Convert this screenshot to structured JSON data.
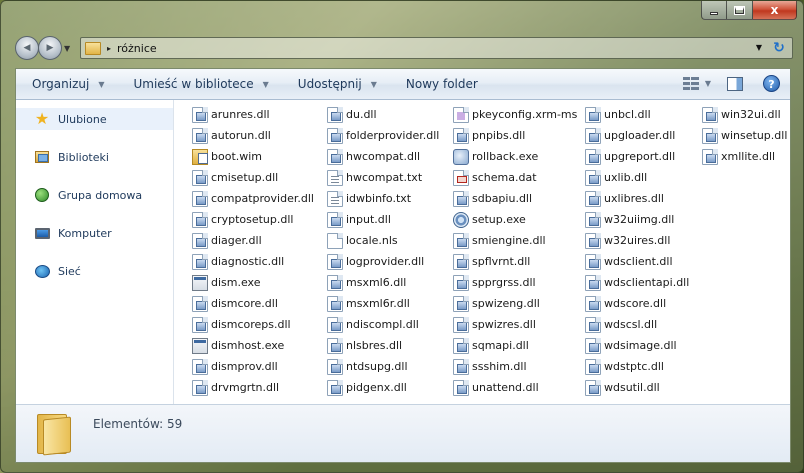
{
  "window": {
    "caption": {
      "minimize": "",
      "maximize": "",
      "close": "x"
    }
  },
  "address_bar": {
    "back_glyph": "◀",
    "forward_glyph": "▶",
    "breadcrumb_separator": "▸",
    "folder": "różnice",
    "dropdown_glyph": "▼",
    "refresh_glyph": "↻"
  },
  "toolbar": {
    "organize": "Organizuj",
    "include_in_library": "Umieść w bibliotece",
    "share": "Udostępnij",
    "new_folder": "Nowy folder",
    "caret": "▼",
    "help": "?"
  },
  "nav_pane": {
    "items": [
      {
        "label": "Ulubione",
        "icon": "star-icon"
      },
      {
        "label": "Biblioteki",
        "icon": "libraries-icon"
      },
      {
        "label": "Grupa domowa",
        "icon": "homegroup-icon"
      },
      {
        "label": "Komputer",
        "icon": "computer-icon"
      },
      {
        "label": "Sieć",
        "icon": "network-icon"
      }
    ]
  },
  "files": {
    "columns": [
      [
        {
          "name": "arunres.dll",
          "type": "dll"
        },
        {
          "name": "autorun.dll",
          "type": "dll"
        },
        {
          "name": "boot.wim",
          "type": "wim"
        },
        {
          "name": "cmisetup.dll",
          "type": "dll"
        },
        {
          "name": "compatprovider.dll",
          "type": "dll"
        },
        {
          "name": "cryptosetup.dll",
          "type": "dll"
        },
        {
          "name": "diager.dll",
          "type": "dll"
        },
        {
          "name": "diagnostic.dll",
          "type": "dll"
        },
        {
          "name": "dism.exe",
          "type": "exe"
        },
        {
          "name": "dismcore.dll",
          "type": "dll"
        },
        {
          "name": "dismcoreps.dll",
          "type": "dll"
        },
        {
          "name": "dismhost.exe",
          "type": "exe"
        },
        {
          "name": "dismprov.dll",
          "type": "dll"
        },
        {
          "name": "drvmgrtn.dll",
          "type": "dll"
        }
      ],
      [
        {
          "name": "du.dll",
          "type": "dll"
        },
        {
          "name": "folderprovider.dll",
          "type": "dll"
        },
        {
          "name": "hwcompat.dll",
          "type": "dll"
        },
        {
          "name": "hwcompat.txt",
          "type": "txt"
        },
        {
          "name": "idwbinfo.txt",
          "type": "txt"
        },
        {
          "name": "input.dll",
          "type": "dll"
        },
        {
          "name": "locale.nls",
          "type": "doc"
        },
        {
          "name": "logprovider.dll",
          "type": "dll"
        },
        {
          "name": "msxml6.dll",
          "type": "dll"
        },
        {
          "name": "msxml6r.dll",
          "type": "dll"
        },
        {
          "name": "ndiscompl.dll",
          "type": "dll"
        },
        {
          "name": "nlsbres.dll",
          "type": "dll"
        },
        {
          "name": "ntdsupg.dll",
          "type": "dll"
        },
        {
          "name": "pidgenx.dll",
          "type": "dll"
        }
      ],
      [
        {
          "name": "pkeyconfig.xrm-ms",
          "type": "ms"
        },
        {
          "name": "pnpibs.dll",
          "type": "dll"
        },
        {
          "name": "rollback.exe",
          "type": "exe2"
        },
        {
          "name": "schema.dat",
          "type": "dat"
        },
        {
          "name": "sdbapiu.dll",
          "type": "dll"
        },
        {
          "name": "setup.exe",
          "type": "gear"
        },
        {
          "name": "smiengine.dll",
          "type": "dll"
        },
        {
          "name": "spflvrnt.dll",
          "type": "dll"
        },
        {
          "name": "spprgrss.dll",
          "type": "dll"
        },
        {
          "name": "spwizeng.dll",
          "type": "dll"
        },
        {
          "name": "spwizres.dll",
          "type": "dll"
        },
        {
          "name": "sqmapi.dll",
          "type": "dll"
        },
        {
          "name": "ssshim.dll",
          "type": "dll"
        },
        {
          "name": "unattend.dll",
          "type": "dll"
        }
      ],
      [
        {
          "name": "unbcl.dll",
          "type": "dll"
        },
        {
          "name": "upgloader.dll",
          "type": "dll"
        },
        {
          "name": "upgreport.dll",
          "type": "dll"
        },
        {
          "name": "uxlib.dll",
          "type": "dll"
        },
        {
          "name": "uxlibres.dll",
          "type": "dll"
        },
        {
          "name": "w32uiimg.dll",
          "type": "dll"
        },
        {
          "name": "w32uires.dll",
          "type": "dll"
        },
        {
          "name": "wdsclient.dll",
          "type": "dll"
        },
        {
          "name": "wdsclientapi.dll",
          "type": "dll"
        },
        {
          "name": "wdscore.dll",
          "type": "dll"
        },
        {
          "name": "wdscsl.dll",
          "type": "dll"
        },
        {
          "name": "wdsimage.dll",
          "type": "dll"
        },
        {
          "name": "wdstptc.dll",
          "type": "dll"
        },
        {
          "name": "wdsutil.dll",
          "type": "dll"
        }
      ],
      [
        {
          "name": "win32ui.dll",
          "type": "dll"
        },
        {
          "name": "winsetup.dll",
          "type": "dll"
        },
        {
          "name": "xmllite.dll",
          "type": "dll"
        }
      ]
    ]
  },
  "details_pane": {
    "item_count": "Elementów: 59"
  },
  "colors": {
    "toolbar_text": "#1e395b",
    "nav_selected_bg": "#e9f1fb",
    "close_button": "#c0381f"
  }
}
